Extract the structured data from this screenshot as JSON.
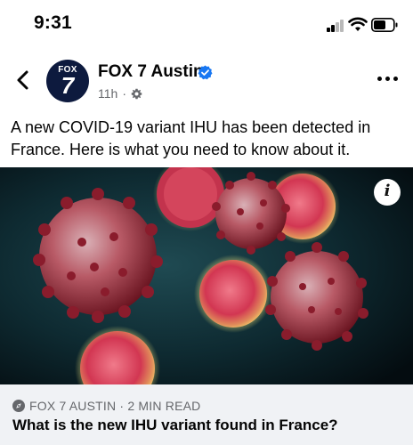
{
  "status_bar": {
    "time": "9:31",
    "icons": [
      "cellular-signal-icon",
      "wifi-icon",
      "battery-icon"
    ]
  },
  "post": {
    "avatar": {
      "top_text": "FOX",
      "number": "7"
    },
    "page_name": "FOX 7 Austin",
    "time_ago": "11h",
    "separator": "·",
    "icons": [
      "back-chevron-icon",
      "verified-badge-icon",
      "gear-icon",
      "more-options-icon"
    ],
    "text": "A new COVID-19 variant IHU has been detected in France. Here is what you need to know about it."
  },
  "link_card": {
    "source": "FOX 7 AUSTIN · 2 MIN READ",
    "title": "What is the new IHU variant found in France?",
    "info_icon_label": "i",
    "source_icon": "compass-icon"
  },
  "colors": {
    "verified_blue": "#1877f2",
    "meta_gray": "#65676b",
    "card_bg": "#f0f2f5",
    "avatar_navy": "#0d1a3e"
  }
}
